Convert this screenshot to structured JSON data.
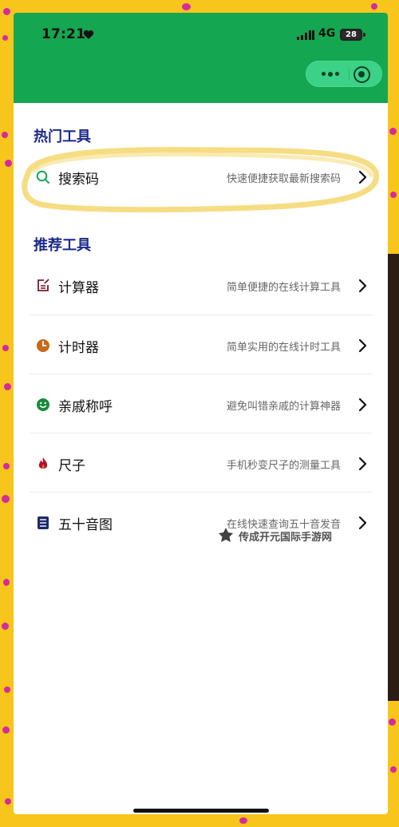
{
  "status_bar": {
    "time": "17:21",
    "network": "4G",
    "battery": "28"
  },
  "header": {
    "bg_color": "#14a650"
  },
  "capsule": {
    "more_icon": "more-dots-icon",
    "close_icon": "target-close-icon"
  },
  "hot_tools": {
    "title": "热门工具",
    "items": [
      {
        "name": "搜索码",
        "desc": "快速便捷获取最新搜索码",
        "icon": "search-icon",
        "icon_color": "#14a650"
      }
    ]
  },
  "recommended_tools": {
    "title": "推荐工具",
    "items": [
      {
        "name": "计算器",
        "desc": "简单便捷的在线计算工具",
        "icon": "edit-square-icon",
        "icon_color": "#7a1b2b"
      },
      {
        "name": "计时器",
        "desc": "简单实用的在线计时工具",
        "icon": "clock-icon",
        "icon_color": "#c56a1a"
      },
      {
        "name": "亲戚称呼",
        "desc": "避免叫错亲戚的计算神器",
        "icon": "smiley-icon",
        "icon_color": "#1a8a3a"
      },
      {
        "name": "尺子",
        "desc": "手机秒变尺子的测量工具",
        "icon": "flame-icon",
        "icon_color": "#b0132a"
      },
      {
        "name": "五十音图",
        "desc": "在线快速查询五十音发音",
        "icon": "kana-table-icon",
        "icon_color": "#1b2a6a"
      }
    ]
  },
  "watermark": {
    "text": "传成开元国际手游网"
  },
  "colors": {
    "accent": "#14a650",
    "section_title": "#1b2a8a",
    "highlight": "#f7df7a"
  }
}
